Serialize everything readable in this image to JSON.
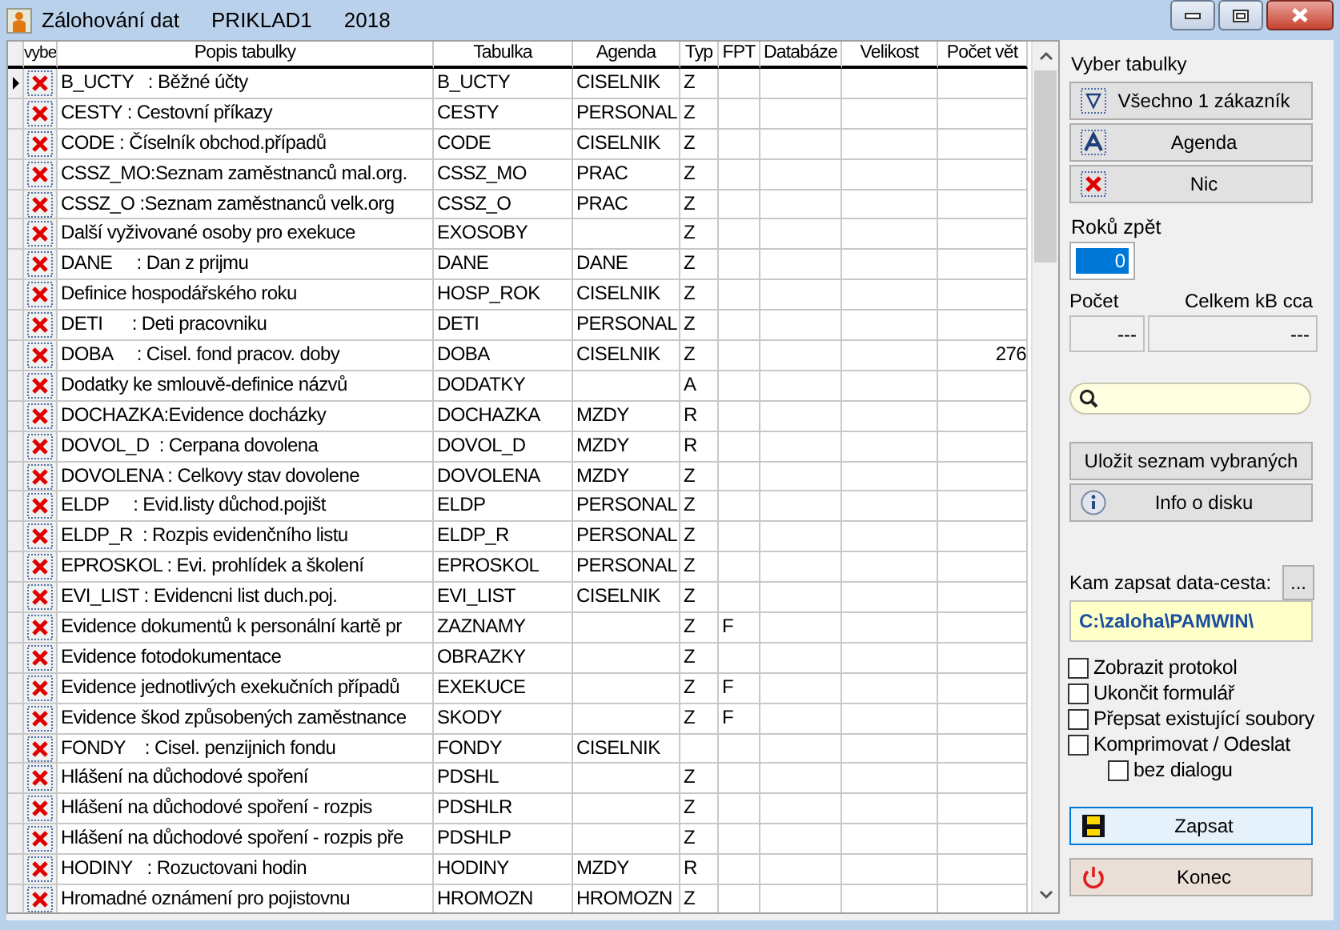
{
  "window": {
    "title": "Zálohování dat",
    "company": "PRIKLAD1",
    "year": "2018"
  },
  "table": {
    "columns": [
      "vybe",
      "Popis tabulky",
      "Tabulka",
      "Agenda",
      "Typ",
      "FPT",
      "Databáze",
      "Velikost",
      "Počet vět"
    ],
    "rows": [
      {
        "current": true,
        "cells": [
          "",
          "B_UCTY   : Běžné účty",
          "B_UCTY",
          "CISELNIK",
          "Z",
          "",
          "",
          "",
          ""
        ]
      },
      {
        "current": false,
        "cells": [
          "",
          "CESTY : Cestovní příkazy",
          "CESTY",
          "PERSONAL",
          "Z",
          "",
          "",
          "",
          ""
        ]
      },
      {
        "current": false,
        "cells": [
          "",
          "CODE : Číselník obchod.případů",
          "CODE",
          "CISELNIK",
          "Z",
          "",
          "",
          "",
          ""
        ]
      },
      {
        "current": false,
        "cells": [
          "",
          "CSSZ_MO:Seznam zaměstnanců mal.org.",
          "CSSZ_MO",
          "PRAC",
          "Z",
          "",
          "",
          "",
          ""
        ]
      },
      {
        "current": false,
        "cells": [
          "",
          "CSSZ_O :Seznam zaměstnanců velk.org",
          "CSSZ_O",
          "PRAC",
          "Z",
          "",
          "",
          "",
          ""
        ]
      },
      {
        "current": false,
        "cells": [
          "",
          "Další vyživované osoby pro exekuce",
          "EXOSOBY",
          "",
          "Z",
          "",
          "",
          "",
          ""
        ]
      },
      {
        "current": false,
        "cells": [
          "",
          "DANE     : Dan z prijmu",
          "DANE",
          "DANE",
          "Z",
          "",
          "",
          "",
          ""
        ]
      },
      {
        "current": false,
        "cells": [
          "",
          "Definice hospodářského roku",
          "HOSP_ROK",
          "CISELNIK",
          "Z",
          "",
          "",
          "",
          ""
        ]
      },
      {
        "current": false,
        "cells": [
          "",
          "DETI      : Deti pracovniku",
          "DETI",
          "PERSONAL",
          "Z",
          "",
          "",
          "",
          ""
        ]
      },
      {
        "current": false,
        "cells": [
          "",
          "DOBA     : Cisel. fond pracov. doby",
          "DOBA",
          "CISELNIK",
          "Z",
          "",
          "",
          "",
          "276"
        ]
      },
      {
        "current": false,
        "cells": [
          "",
          "Dodatky ke smlouvě-definice názvů",
          "DODATKY",
          "",
          "A",
          "",
          "",
          "",
          ""
        ]
      },
      {
        "current": false,
        "cells": [
          "",
          "DOCHAZKA:Evidence docházky",
          "DOCHAZKA",
          "MZDY",
          "R",
          "",
          "",
          "",
          ""
        ]
      },
      {
        "current": false,
        "cells": [
          "",
          "DOVOL_D  : Cerpana dovolena",
          "DOVOL_D",
          "MZDY",
          "R",
          "",
          "",
          "",
          ""
        ]
      },
      {
        "current": false,
        "cells": [
          "",
          "DOVOLENA : Celkovy stav dovolene",
          "DOVOLENA",
          "MZDY",
          "Z",
          "",
          "",
          "",
          ""
        ]
      },
      {
        "current": false,
        "cells": [
          "",
          "ELDP     : Evid.listy důchod.pojišt",
          "ELDP",
          "PERSONAL",
          "Z",
          "",
          "",
          "",
          ""
        ]
      },
      {
        "current": false,
        "cells": [
          "",
          "ELDP_R  : Rozpis evidenčního listu",
          "ELDP_R",
          "PERSONAL",
          "Z",
          "",
          "",
          "",
          ""
        ]
      },
      {
        "current": false,
        "cells": [
          "",
          "EPROSKOL : Evi. prohlídek a školení",
          "EPROSKOL",
          "PERSONAL",
          "Z",
          "",
          "",
          "",
          ""
        ]
      },
      {
        "current": false,
        "cells": [
          "",
          "EVI_LIST : Evidencni list duch.poj.",
          "EVI_LIST",
          "CISELNIK",
          "Z",
          "",
          "",
          "",
          ""
        ]
      },
      {
        "current": false,
        "cells": [
          "",
          "Evidence dokumentů k personální kartě pr",
          "ZAZNAMY",
          "",
          "Z",
          "F",
          "",
          "",
          ""
        ]
      },
      {
        "current": false,
        "cells": [
          "",
          "Evidence fotodokumentace",
          "OBRAZKY",
          "",
          "Z",
          "",
          "",
          "",
          ""
        ]
      },
      {
        "current": false,
        "cells": [
          "",
          "Evidence jednotlivých exekučních případů",
          "EXEKUCE",
          "",
          "Z",
          "F",
          "",
          "",
          ""
        ]
      },
      {
        "current": false,
        "cells": [
          "",
          "Evidence škod způsobených zaměstnance",
          "SKODY",
          "",
          "Z",
          "F",
          "",
          "",
          ""
        ]
      },
      {
        "current": false,
        "cells": [
          "",
          "FONDY    : Cisel. penzijnich fondu",
          "FONDY",
          "CISELNIK",
          "",
          "",
          "",
          "",
          ""
        ]
      },
      {
        "current": false,
        "cells": [
          "",
          "Hlášení na důchodové spoření",
          "PDSHL",
          "",
          "Z",
          "",
          "",
          "",
          ""
        ]
      },
      {
        "current": false,
        "cells": [
          "",
          "Hlášení na důchodové spoření - rozpis",
          "PDSHLR",
          "",
          "Z",
          "",
          "",
          "",
          ""
        ]
      },
      {
        "current": false,
        "cells": [
          "",
          "Hlášení na důchodové spoření - rozpis pře",
          "PDSHLP",
          "",
          "Z",
          "",
          "",
          "",
          ""
        ]
      },
      {
        "current": false,
        "cells": [
          "",
          "HODINY   : Rozuctovani hodin",
          "HODINY",
          "MZDY",
          "R",
          "",
          "",
          "",
          ""
        ]
      },
      {
        "current": false,
        "cells": [
          "",
          "Hromadné oznámení pro pojistovnu",
          "HROMOZN",
          "HROMOZN",
          "Z",
          "",
          "",
          "",
          ""
        ]
      }
    ]
  },
  "panel": {
    "select_label": "Vyber tabulky",
    "select_buttons": [
      {
        "kind": "filter",
        "label": "Všechno 1 zákazník"
      },
      {
        "kind": "agenda",
        "label": "Agenda"
      },
      {
        "kind": "none",
        "label": "Nic"
      }
    ],
    "years_label": "Roků zpět",
    "years_value": "0",
    "count_label": "Počet",
    "total_label": "Celkem kB cca",
    "count_value": "---",
    "total_value": "---",
    "save_list_button": "Uložit seznam vybraných",
    "disk_info_button": "Info o disku",
    "path_label": "Kam zapsat data-cesta:",
    "browse_button": "...",
    "path_value": "C:\\zaloha\\PAMWIN\\",
    "options": [
      {
        "label": "Zobrazit protokol",
        "checked": false
      },
      {
        "label": "Ukončit formulář",
        "checked": false
      },
      {
        "label": "Přepsat existující soubory",
        "checked": false
      },
      {
        "label": "Komprimovat / Odeslat",
        "checked": false,
        "children": [
          {
            "label": "bez dialogu",
            "checked": false
          }
        ]
      }
    ],
    "write_button": "Zapsat",
    "exit_button": "Konec"
  }
}
